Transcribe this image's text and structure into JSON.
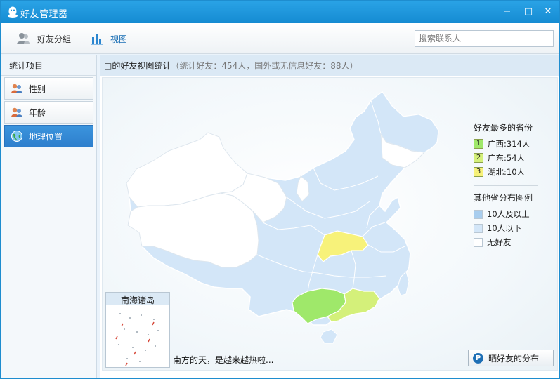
{
  "window": {
    "title": "好友管理器",
    "minimize": "−",
    "maximize": "□",
    "close": "✕"
  },
  "toolbar": {
    "groups_label": "好友分組",
    "view_label": "视图",
    "search_placeholder": "搜索联系人"
  },
  "sidebar": {
    "header": "统计项目",
    "items": [
      {
        "label": "性别",
        "icon": "people-icon",
        "active": false
      },
      {
        "label": "年龄",
        "icon": "people-icon",
        "active": false
      },
      {
        "label": "地理位置",
        "icon": "globe-icon",
        "active": true
      }
    ]
  },
  "main": {
    "title_prefix": "□的好友视图统计",
    "title_stats": "（统计好友：454人，国外或无信息好友：88人）"
  },
  "legend": {
    "top_title": "好友最多的省份",
    "top": [
      {
        "rank": "1",
        "text": "广西:314人",
        "color": "#9fe86a"
      },
      {
        "rank": "2",
        "text": "广东:54人",
        "color": "#d4f07a"
      },
      {
        "rank": "3",
        "text": "湖北:10人",
        "color": "#f7f27a"
      }
    ],
    "other_title": "其他省分布图例",
    "other": [
      {
        "text": "10人及以上",
        "color": "#a8cdee"
      },
      {
        "text": "10人以下",
        "color": "#d3e6f8"
      },
      {
        "text": "无好友",
        "color": "#ffffff"
      }
    ]
  },
  "map": {
    "inset_title": "南海诸岛",
    "caption": "南方的天，是越来越热啦...",
    "share_label": "晒好友的分布"
  }
}
